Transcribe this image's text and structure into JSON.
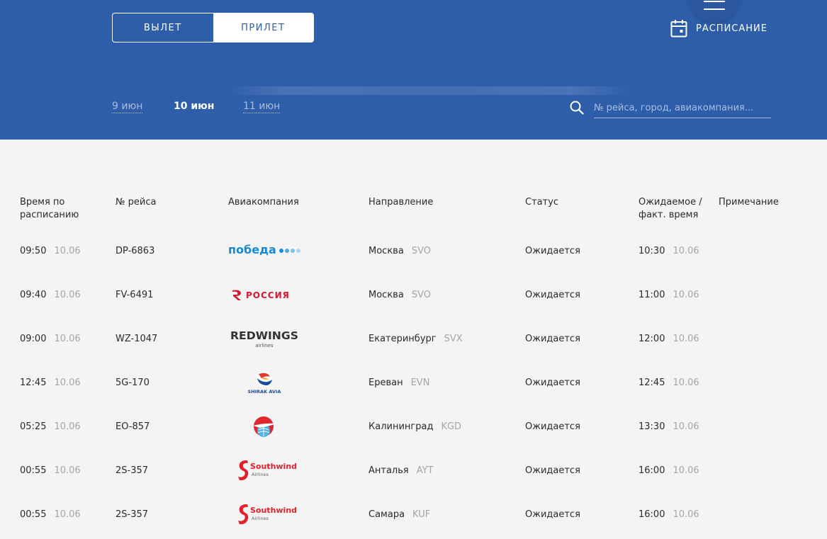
{
  "nav": {
    "tabs": [
      {
        "label": "ВЫЛЕТ",
        "active": true
      },
      {
        "label": "ПРИЛЕТ",
        "active": false
      }
    ],
    "menu_icon": "hamburger-icon",
    "schedule_label": "РАСПИСАНИЕ",
    "schedule_icon": "calendar-icon"
  },
  "dates": [
    {
      "label": "9 июн",
      "current": false
    },
    {
      "label": "10 июн",
      "current": true
    },
    {
      "label": "11 июн",
      "current": false
    }
  ],
  "search": {
    "placeholder": "№ рейса, город, авиакомпания...",
    "icon": "search-icon"
  },
  "table": {
    "headers": {
      "time": "Время по расписанию",
      "flight": "№ рейса",
      "airline": "Авиакомпания",
      "direction": "Направление",
      "status": "Статус",
      "actual": "Ожидаемое / факт. время",
      "note": "Примечание"
    },
    "rows": [
      {
        "time": "09:50",
        "date": "10.06",
        "flight": "DP-6863",
        "airline_logo": "pobeda-logo",
        "logo_text": "победа",
        "city": "Москва",
        "code": "SVO",
        "status": "Ожидается",
        "actual_time": "10:30",
        "actual_date": "10.06"
      },
      {
        "time": "09:40",
        "date": "10.06",
        "flight": "FV-6491",
        "airline_logo": "rossiya-logo",
        "logo_text": "РОССИЯ",
        "city": "Москва",
        "code": "SVO",
        "status": "Ожидается",
        "actual_time": "11:00",
        "actual_date": "10.06"
      },
      {
        "time": "09:00",
        "date": "10.06",
        "flight": "WZ-1047",
        "airline_logo": "redwings-logo",
        "logo_text": "REDWINGS",
        "logo_sub": "airlines",
        "city": "Екатеринбург",
        "code": "SVX",
        "status": "Ожидается",
        "actual_time": "12:00",
        "actual_date": "10.06"
      },
      {
        "time": "12:45",
        "date": "10.06",
        "flight": "5G-170",
        "airline_logo": "shirak-avia-logo",
        "logo_text": "SHIRAK AVIA",
        "city": "Ереван",
        "code": "EVN",
        "status": "Ожидается",
        "actual_time": "12:45",
        "actual_date": "10.06"
      },
      {
        "time": "05:25",
        "date": "10.06",
        "flight": "EO-857",
        "airline_logo": "pegas-logo",
        "city": "Калининград",
        "code": "KGD",
        "status": "Ожидается",
        "actual_time": "13:30",
        "actual_date": "10.06"
      },
      {
        "time": "00:55",
        "date": "10.06",
        "flight": "2S-357",
        "airline_logo": "southwind-logo",
        "logo_text": "Southwind",
        "logo_sub": "Airlines",
        "city": "Анталья",
        "code": "AYT",
        "status": "Ожидается",
        "actual_time": "16:00",
        "actual_date": "10.06"
      },
      {
        "time": "00:55",
        "date": "10.06",
        "flight": "2S-357",
        "airline_logo": "southwind-logo",
        "logo_text": "Southwind",
        "logo_sub": "Airlines",
        "city": "Самара",
        "code": "KUF",
        "status": "Ожидается",
        "actual_time": "16:00",
        "actual_date": "10.06"
      }
    ]
  },
  "colors": {
    "header": "#2e5eaa",
    "background": "#f4f4f4",
    "muted": "#a5a5a5",
    "text": "#2a2a2a",
    "link_dim": "#a8bde0"
  }
}
